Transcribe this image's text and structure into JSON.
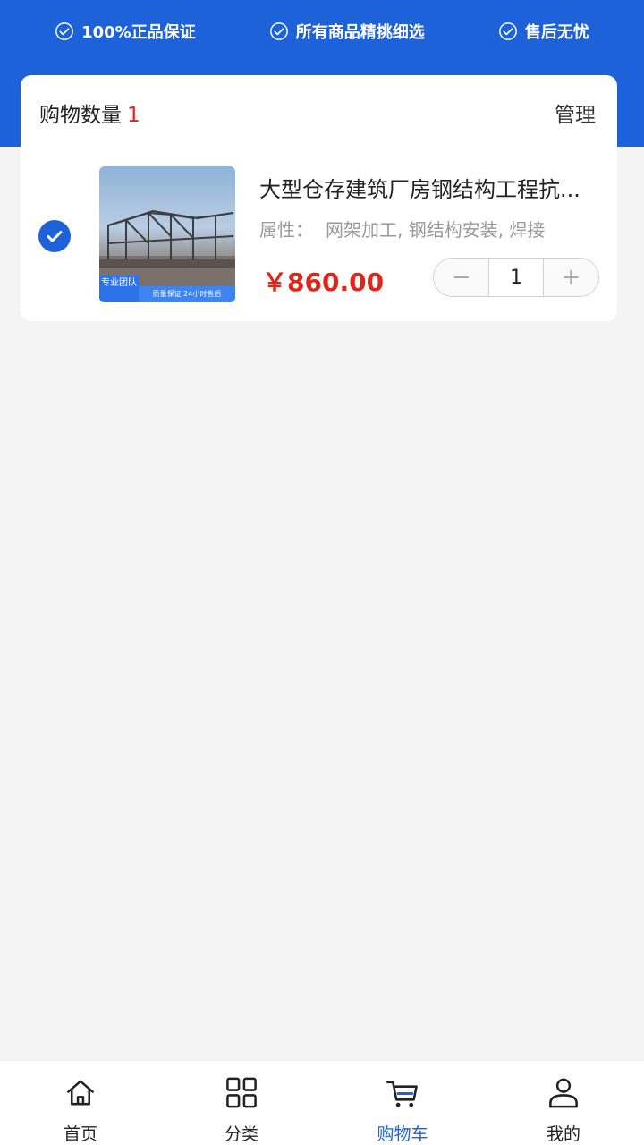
{
  "header": {
    "guarantees": [
      {
        "icon": "check-circle-icon",
        "label": "100%正品保证"
      },
      {
        "icon": "check-circle-icon",
        "label": "所有商品精挑细选"
      },
      {
        "icon": "check-circle-icon",
        "label": "售后无忧"
      }
    ],
    "accent_color": "#1d62d9"
  },
  "cart": {
    "count_label": "购物数量",
    "count_value": "1",
    "manage_label": "管理",
    "items": [
      {
        "selected": true,
        "title": "大型仓存建筑厂房钢结构工程抗...",
        "attr_label": "属性：",
        "attr_value": "网架加工, 钢结构安装, 焊接",
        "price": "￥860.00",
        "quantity": "1",
        "thumb_badge": "专业团队",
        "thumb_strip": "质量保证 24小时售后",
        "minus": "−",
        "plus": "+"
      }
    ],
    "price_color": "#e1251b"
  },
  "tabbar": {
    "tabs": [
      {
        "icon": "home-icon",
        "label": "首页",
        "active": false
      },
      {
        "icon": "category-grid-icon",
        "label": "分类",
        "active": false
      },
      {
        "icon": "cart-icon",
        "label": "购物车",
        "active": true
      },
      {
        "icon": "user-icon",
        "label": "我的",
        "active": false
      }
    ]
  }
}
